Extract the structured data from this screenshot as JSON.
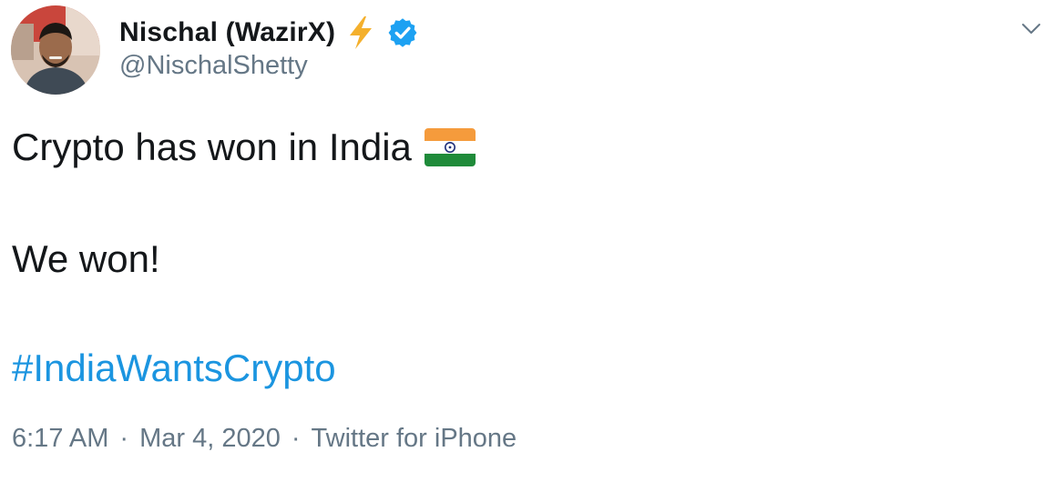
{
  "author": {
    "display_name": "Nischal (WazirX)",
    "handle": "@NischalShetty",
    "name_emoji": "lightning-bolt",
    "verified": true
  },
  "tweet": {
    "line1": "Crypto has won in India",
    "line1_emoji": "flag-india",
    "line2": "We won!",
    "hashtag": "#IndiaWantsCrypto"
  },
  "meta": {
    "time": "6:17 AM",
    "separator": "·",
    "date": "Mar 4, 2020",
    "source": "Twitter for iPhone"
  },
  "colors": {
    "text": "#14171a",
    "secondary": "#657786",
    "link": "#1b95e0",
    "verified_badge": "#1da1f2",
    "bolt": "#f4b02d"
  }
}
